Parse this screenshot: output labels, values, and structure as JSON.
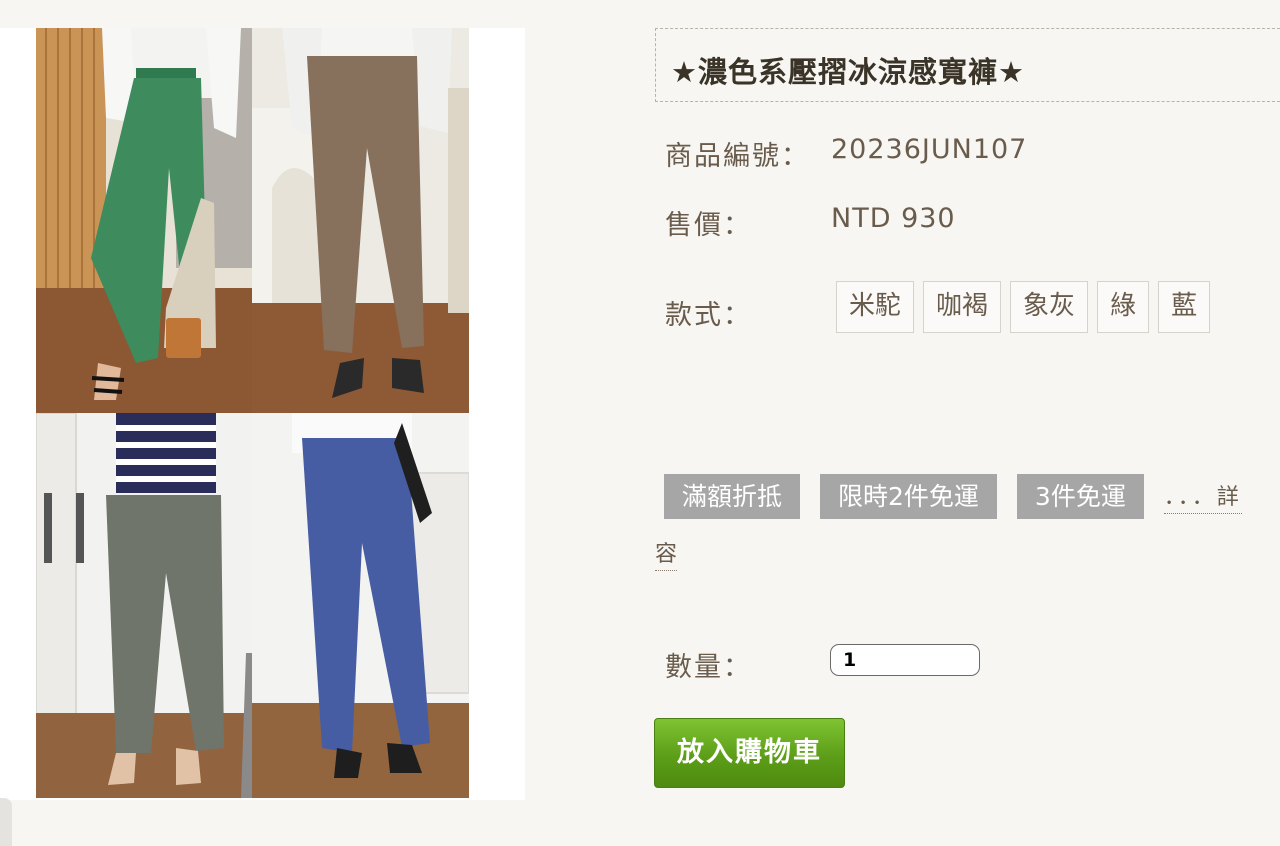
{
  "product": {
    "title": "★濃色系壓摺冰涼感寬褲★",
    "code_label": "商品編號：",
    "code": "20236JUN107",
    "price_label": "售價：",
    "price": "NTD 930",
    "style_label": "款式：",
    "styles": [
      "米駝",
      "咖褐",
      "象灰",
      "綠",
      "藍"
    ],
    "quantity_label": "數量：",
    "quantity": "1",
    "add_to_cart": "放入購物車"
  },
  "promotions": {
    "tags": [
      "滿額折抵",
      "限時2件免運",
      "3件免運"
    ],
    "more_text": "．．．詳",
    "more_wrap": "容"
  },
  "photos": [
    {
      "pants_color": "#3e8c5e"
    },
    {
      "pants_color": "#87705c"
    },
    {
      "pants_color": "#6f756a"
    },
    {
      "pants_color": "#465da3"
    }
  ]
}
